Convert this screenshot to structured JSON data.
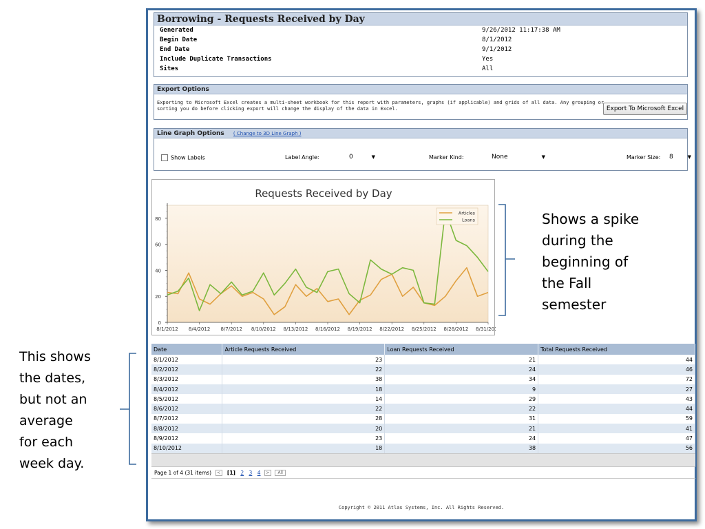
{
  "report": {
    "title": "Borrowing - Requests Received by Day",
    "params": [
      {
        "label": "Generated",
        "value": "9/26/2012 11:17:38 AM"
      },
      {
        "label": "Begin Date",
        "value": "8/1/2012"
      },
      {
        "label": "End Date",
        "value": "9/1/2012"
      },
      {
        "label": "Include Duplicate Transactions",
        "value": "Yes"
      },
      {
        "label": "Sites",
        "value": "All"
      }
    ]
  },
  "export": {
    "title": "Export Options",
    "text": "Exporting to Microsoft Excel creates a multi-sheet workbook for this report with parameters, graphs (if applicable) and grids of all data. Any grouping or sorting you do before clicking export will change the display of the data in Excel.",
    "button": "Export To Microsoft Excel"
  },
  "graph_options": {
    "title": "Line Graph Options",
    "link": "( Change to 3D Line Graph )",
    "show_labels": "Show Labels",
    "label_angle_label": "Label Angle:",
    "label_angle_value": "0",
    "marker_kind_label": "Marker Kind:",
    "marker_kind_value": "None",
    "marker_size_label": "Marker Size:",
    "marker_size_value": "8"
  },
  "chart_data": {
    "type": "line",
    "title": "Requests Received by Day",
    "x_tick_labels": [
      "8/1/2012",
      "8/4/2012",
      "8/7/2012",
      "8/10/2012",
      "8/13/2012",
      "8/16/2012",
      "8/19/2012",
      "8/22/2012",
      "8/25/2012",
      "8/28/2012",
      "8/31/2012"
    ],
    "y_ticks": [
      0,
      20,
      40,
      60,
      80
    ],
    "ylim": [
      0,
      90
    ],
    "legend_position": "top-right",
    "series": [
      {
        "name": "Articles",
        "color": "#e0a040",
        "values": [
          23,
          22,
          38,
          18,
          14,
          22,
          28,
          20,
          23,
          18,
          6,
          12,
          29,
          20,
          26,
          16,
          18,
          6,
          17,
          21,
          33,
          37,
          20,
          27,
          15,
          13,
          20,
          32,
          42,
          20,
          23
        ]
      },
      {
        "name": "Loans",
        "color": "#7cb83e",
        "values": [
          21,
          24,
          34,
          9,
          29,
          22,
          31,
          21,
          24,
          38,
          21,
          30,
          41,
          27,
          23,
          39,
          41,
          22,
          15,
          48,
          41,
          37,
          42,
          40,
          15,
          14,
          86,
          63,
          59,
          50,
          39
        ]
      }
    ]
  },
  "grid": {
    "headers": [
      "Date",
      "Article Requests Received",
      "Loan Requests Received",
      "Total Requests Received"
    ],
    "rows": [
      [
        "8/1/2012",
        "23",
        "21",
        "44"
      ],
      [
        "8/2/2012",
        "22",
        "24",
        "46"
      ],
      [
        "8/3/2012",
        "38",
        "34",
        "72"
      ],
      [
        "8/4/2012",
        "18",
        "9",
        "27"
      ],
      [
        "8/5/2012",
        "14",
        "29",
        "43"
      ],
      [
        "8/6/2012",
        "22",
        "22",
        "44"
      ],
      [
        "8/7/2012",
        "28",
        "31",
        "59"
      ],
      [
        "8/8/2012",
        "20",
        "21",
        "41"
      ],
      [
        "8/9/2012",
        "23",
        "24",
        "47"
      ],
      [
        "8/10/2012",
        "18",
        "38",
        "56"
      ]
    ],
    "pager": {
      "summary": "Page 1 of 4 (31 items)",
      "prev": "<",
      "current": "[1]",
      "pages": [
        "2",
        "3",
        "4"
      ],
      "next": ">",
      "all": "All"
    }
  },
  "copyright": "Copyright © 2011 Atlas Systems, Inc. All Rights Reserved.",
  "annotations": {
    "right": [
      "Shows a spike",
      "during the",
      "beginning of",
      "the Fall",
      "semester"
    ],
    "left": [
      "This shows",
      "the dates,",
      "but not an",
      "average",
      "for each",
      "week day."
    ]
  }
}
